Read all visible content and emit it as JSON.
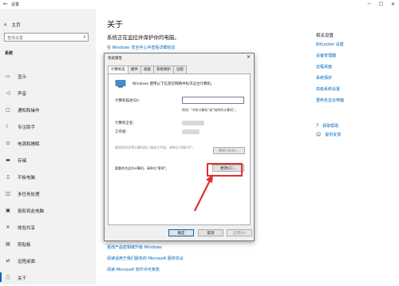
{
  "window": {
    "title": "设置"
  },
  "sidebar": {
    "home": "主页",
    "search_placeholder": "查找设置",
    "section": "系统",
    "items": [
      {
        "label": "显示",
        "icon": "display-icon"
      },
      {
        "label": "声音",
        "icon": "sound-icon"
      },
      {
        "label": "通知和操作",
        "icon": "notification-icon"
      },
      {
        "label": "专注助手",
        "icon": "focus-assist-icon"
      },
      {
        "label": "电源和睡眠",
        "icon": "power-icon"
      },
      {
        "label": "存储",
        "icon": "storage-icon"
      },
      {
        "label": "平板电脑",
        "icon": "tablet-icon"
      },
      {
        "label": "多任务处理",
        "icon": "multitasking-icon"
      },
      {
        "label": "投影到此电脑",
        "icon": "projecting-icon"
      },
      {
        "label": "体验共享",
        "icon": "shared-experiences-icon"
      },
      {
        "label": "剪贴板",
        "icon": "clipboard-icon"
      },
      {
        "label": "远程桌面",
        "icon": "remote-desktop-icon"
      },
      {
        "label": "关于",
        "icon": "info-icon",
        "active": true
      }
    ]
  },
  "main": {
    "title": "关于",
    "subtitle": "系统正在监控并保护你的电脑。",
    "security_link": "在 Windows 安全中心中查看详细信息",
    "related": {
      "heading": "相关设置",
      "links": [
        "BitLocker 设置",
        "设备管理器",
        "远程桌面",
        "系统保护",
        "高级系统设置",
        "重命名这台电脑"
      ]
    },
    "help": [
      {
        "label": "获取帮助",
        "icon": "help-icon"
      },
      {
        "label": "提供反馈",
        "icon": "feedback-icon"
      }
    ],
    "bottom_links": [
      "更改产品密钥或升级 Windows",
      "阅读适用于我们服务的 Microsoft 服务协议",
      "阅读 Microsoft 软件许可条款"
    ]
  },
  "dialog": {
    "title": "系统属性",
    "tabs": [
      "计算机名",
      "硬件",
      "高级",
      "系统保护",
      "远程"
    ],
    "intro": "Windows 使用以下信息在网络中标识这台计算机。",
    "desc_label": "计算机描述(D):",
    "desc_value": "",
    "example": "例如: \"书房计算机\"或\"瑞特的计算机\"。",
    "fullname_label": "计算机全名:",
    "workgroup_label": "工作组:",
    "network_id_text": "要使用向导将计算机加入域或工作组，请单击\"网络 ID\"。",
    "network_id_button": "网络 ID(N)...",
    "rename_text": "要重命名这台计算机，请单击\"更改\"。",
    "change_button": "更改(C)...",
    "ok_button": "确定",
    "cancel_button": "取消",
    "apply_button": "应用(A)"
  }
}
